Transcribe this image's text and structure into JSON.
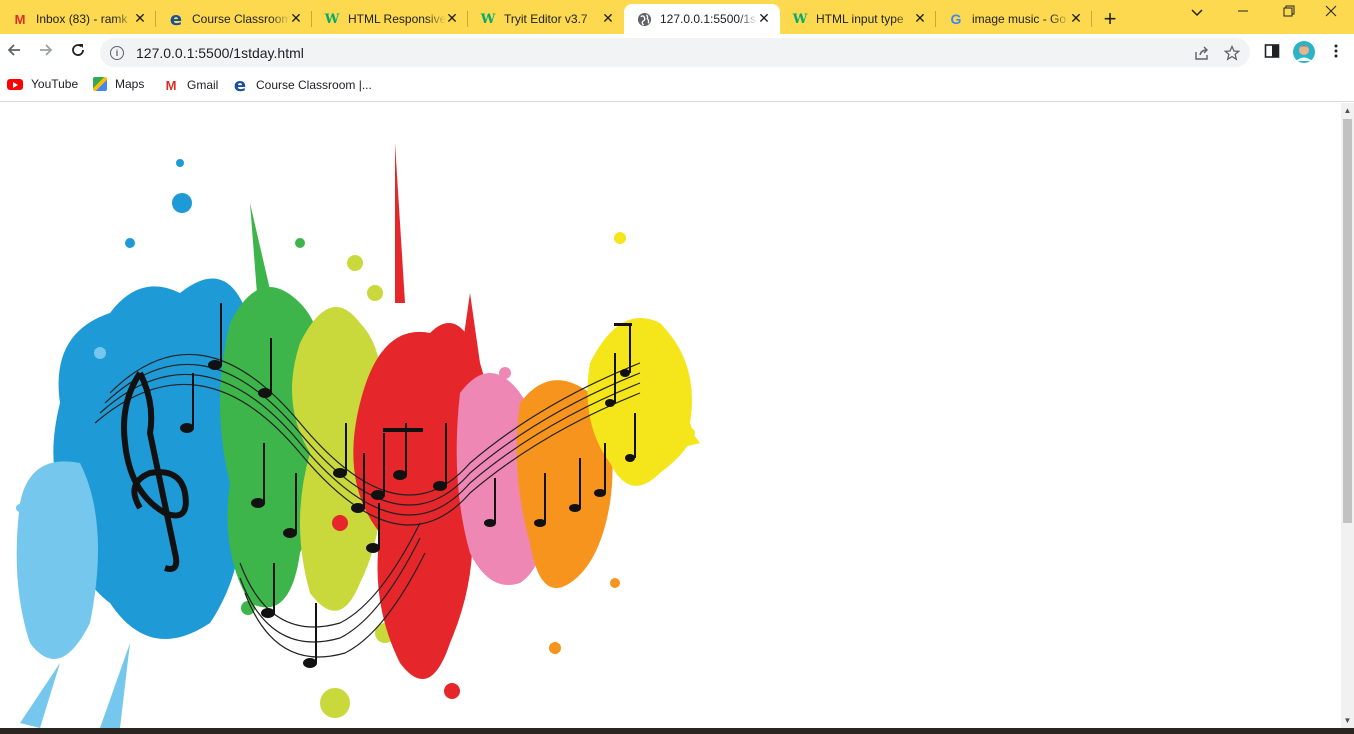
{
  "tabs": [
    {
      "title": "Inbox (83) - ramk",
      "icon": "gmail-icon",
      "active": false
    },
    {
      "title": "Course Classroom",
      "icon": "edureka-icon",
      "active": false
    },
    {
      "title": "HTML Responsive",
      "icon": "w3schools-icon",
      "active": false
    },
    {
      "title": "Tryit Editor v3.7",
      "icon": "w3schools-icon",
      "active": false
    },
    {
      "title": "127.0.0.1:5500/1s",
      "icon": "globe-icon",
      "active": true
    },
    {
      "title": "HTML input type",
      "icon": "w3schools-icon",
      "active": false
    },
    {
      "title": "image music - Go",
      "icon": "google-icon",
      "active": false
    }
  ],
  "toolbar": {
    "url": "127.0.0.1:5500/1stday.html"
  },
  "bookmarks": [
    {
      "label": "YouTube",
      "icon": "youtube-icon"
    },
    {
      "label": "Maps",
      "icon": "maps-icon"
    },
    {
      "label": "Gmail",
      "icon": "gmail-icon"
    },
    {
      "label": "Course Classroom |...",
      "icon": "edureka-icon"
    }
  ],
  "colors": {
    "tabbar": "#fcd94f",
    "splash_blue": "#1e9bd7",
    "splash_green": "#3db54a",
    "splash_lime": "#c9d93b",
    "splash_red": "#e5262b",
    "splash_pink": "#ee87b4",
    "splash_orange": "#f7941d",
    "splash_yellow": "#f5e61c"
  }
}
